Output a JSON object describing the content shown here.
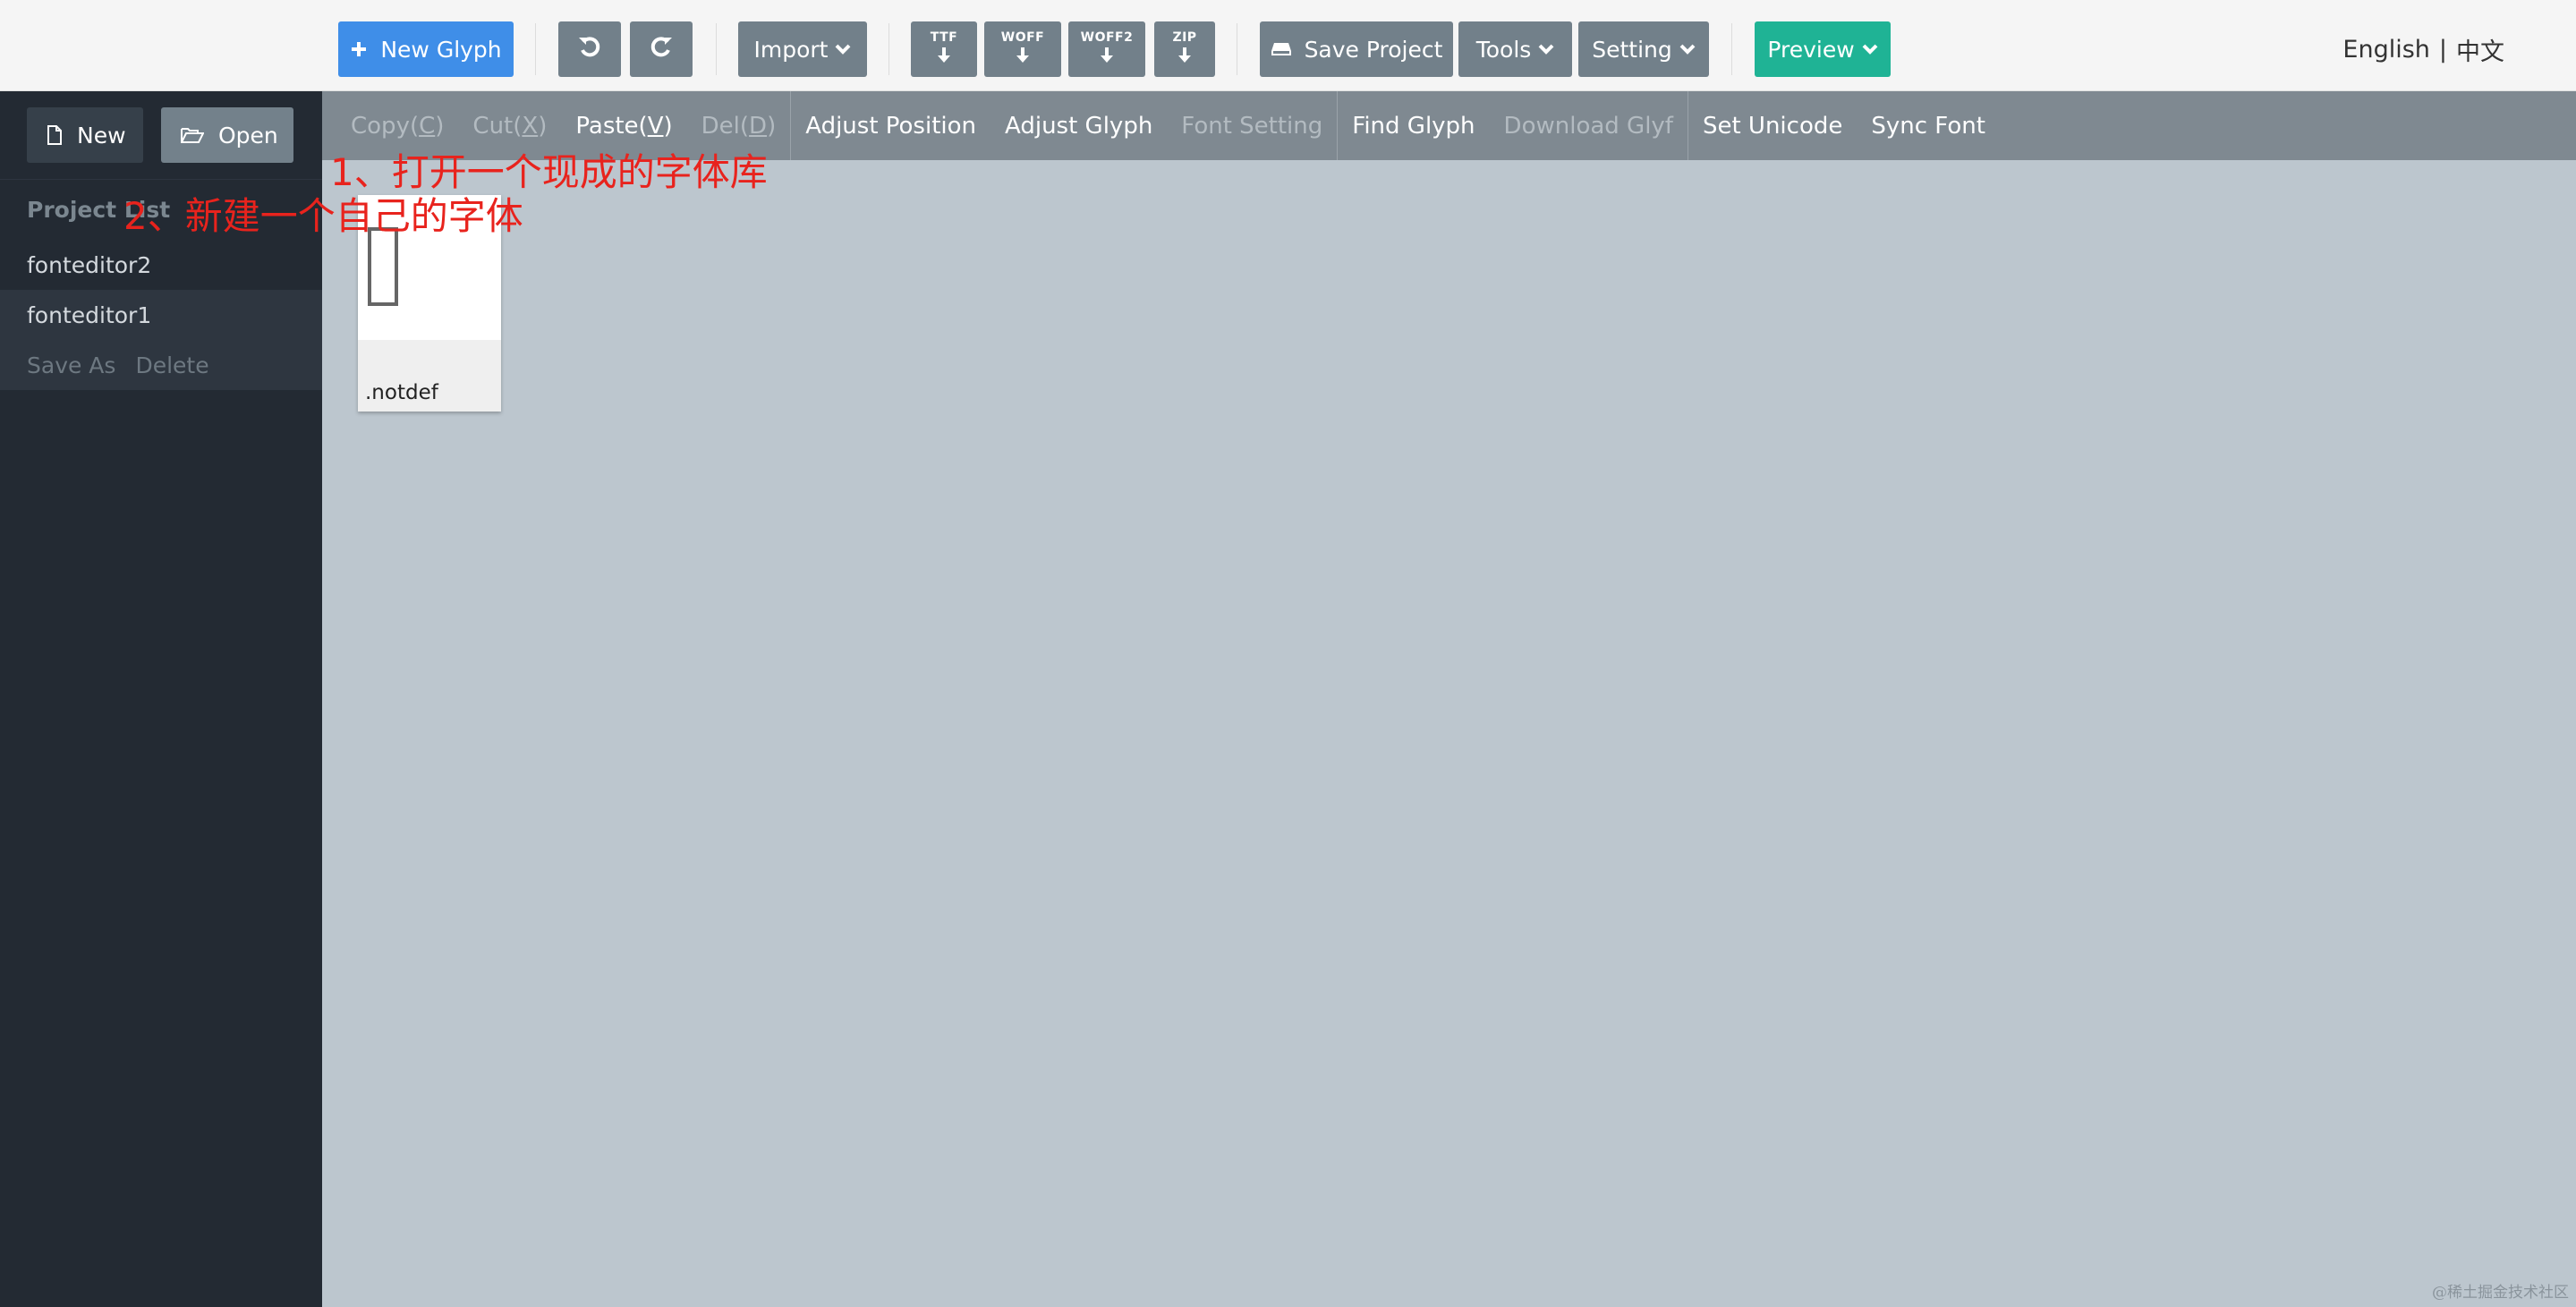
{
  "toolbar": {
    "new_glyph": "New Glyph",
    "import": "Import",
    "export_formats": [
      "TTF",
      "WOFF",
      "WOFF2",
      "ZIP"
    ],
    "save_project": "Save Project",
    "tools": "Tools",
    "setting": "Setting",
    "preview": "Preview"
  },
  "language": {
    "english": "English",
    "separator": "|",
    "chinese": "中文"
  },
  "sidebar": {
    "new": "New",
    "open": "Open",
    "project_list_title": "Project List",
    "projects": [
      "fonteditor2",
      "fonteditor1"
    ],
    "save_as": "Save As",
    "delete": "Delete"
  },
  "editbar": {
    "copy": "Copy(",
    "copy_key": "C",
    "cut": "Cut(",
    "cut_key": "X",
    "paste": "Paste(",
    "paste_key": "V",
    "del": "Del(",
    "del_key": "D",
    "close_paren": ")",
    "adjust_position": "Adjust Position",
    "adjust_glyph": "Adjust Glyph",
    "font_setting": "Font Setting",
    "find_glyph": "Find Glyph",
    "download_glyf": "Download Glyf",
    "set_unicode": "Set Unicode",
    "sync_font": "Sync Font"
  },
  "glyphs": [
    {
      "name": ".notdef"
    }
  ],
  "annotations": {
    "open_note": "1、打开一个现成的字体库",
    "new_note": "2、新建一个自己的字体"
  },
  "watermark": "@稀土掘金技术社区",
  "colors": {
    "primary_blue": "#3f8ee8",
    "preview_green": "#1fb395",
    "sidebar_bg": "#232a33",
    "canvas_bg": "#bcc6ce",
    "annotation_red": "#e8231d"
  },
  "icons": {
    "new_glyph": "plus-icon",
    "undo": "undo-icon",
    "redo": "redo-icon",
    "download": "download-arrow-icon",
    "save": "drive-icon",
    "dropdown": "chevron-down-icon",
    "new": "file-icon",
    "open": "folder-open-icon"
  }
}
